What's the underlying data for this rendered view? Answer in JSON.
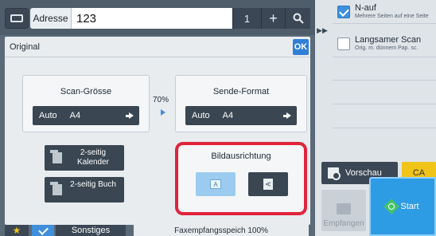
{
  "header": {
    "keyboard_icon": "keyboard-icon",
    "address_label": "Adresse",
    "address_value": "123",
    "count": "1",
    "plus_label": "+",
    "search_icon": "search-icon"
  },
  "sidebar": {
    "collapse_arrow": "▶▶",
    "options": [
      {
        "title": "N-auf",
        "sub": "Mehrere Seiten auf eine Seite",
        "checked": true
      },
      {
        "title": "Langsamer Scan",
        "sub": "Orig. m. dünnem Pap. sc.",
        "checked": false
      }
    ],
    "preview_label": "Vorschau",
    "ca_label": "CA",
    "receive_label": "Empfangen",
    "start_label": "Start"
  },
  "dialog": {
    "title": "Original",
    "ok_label": "OK",
    "scan_size": {
      "title": "Scan-Grösse",
      "mode": "Auto",
      "size": "A4"
    },
    "ratio": "70%",
    "send_size": {
      "title": "Sende-Format",
      "mode": "Auto",
      "size": "A4"
    },
    "duplex_calendar": "2-seitig Kalender",
    "duplex_book": "2-seitig Buch",
    "orientation": {
      "title": "Bildausrichtung",
      "option_a": "A",
      "option_b": "A"
    }
  },
  "footer": {
    "others_label": "Sonstiges",
    "memory_text": "Faxempfangsspeich 100%"
  },
  "colors": {
    "accent": "#2f7fd6",
    "highlight": "#e0243b",
    "start": "#2e9be5",
    "ca": "#f0c419"
  }
}
